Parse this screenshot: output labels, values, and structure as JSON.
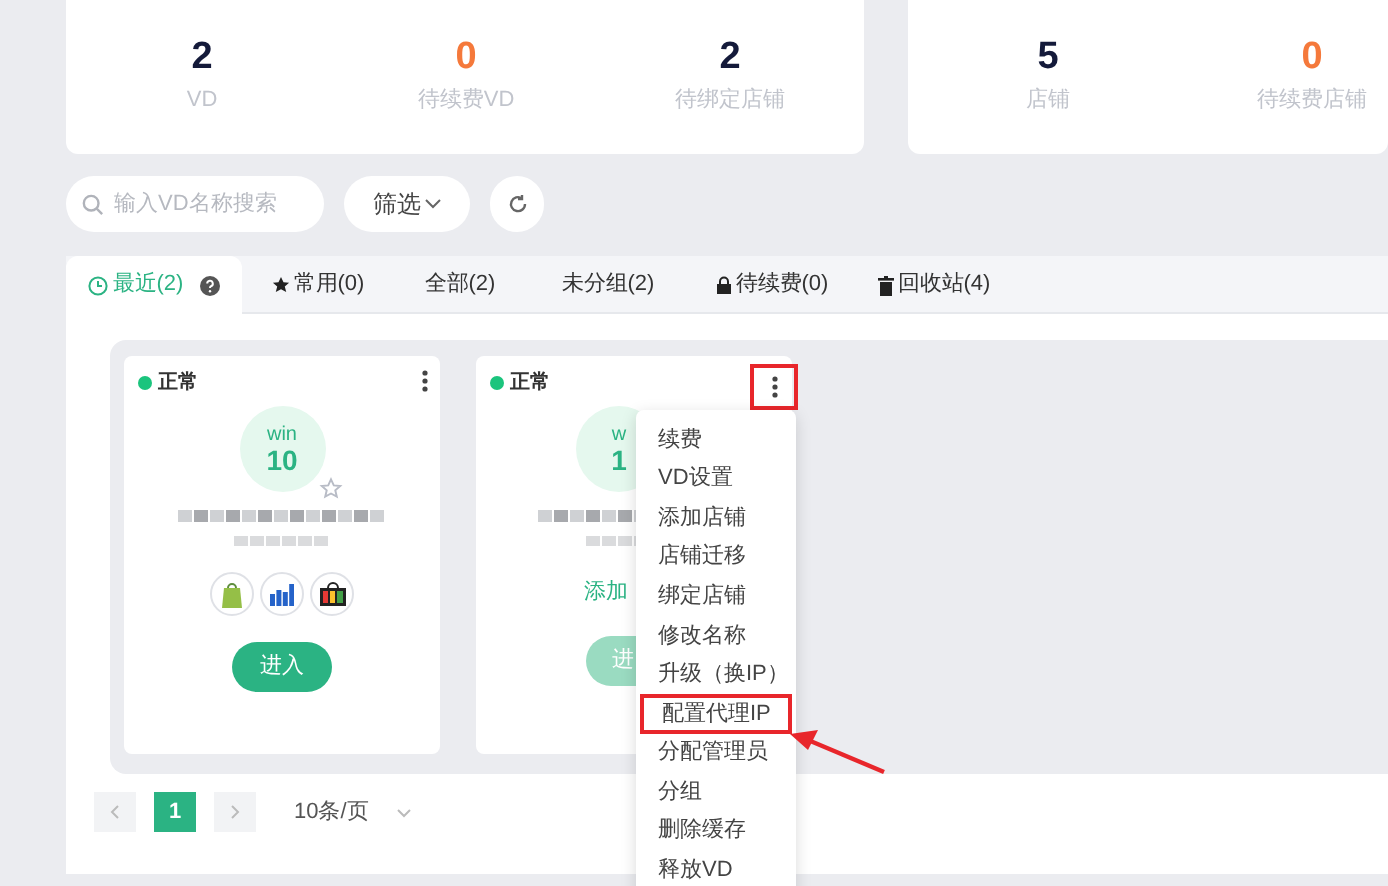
{
  "stats_left": [
    {
      "value": "2",
      "label": "VD",
      "kind": "normal"
    },
    {
      "value": "0",
      "label": "待续费VD",
      "kind": "warning"
    },
    {
      "value": "2",
      "label": "待绑定店铺",
      "kind": "normal"
    }
  ],
  "stats_right": [
    {
      "value": "5",
      "label": "店铺",
      "kind": "normal"
    },
    {
      "value": "0",
      "label": "待续费店铺",
      "kind": "warning"
    }
  ],
  "search": {
    "placeholder": "输入VD名称搜索"
  },
  "filter_button": "筛选",
  "tabs": [
    {
      "label": "最近(2)",
      "kind": "recent",
      "selected": true,
      "help": true
    },
    {
      "label": "常用(0)",
      "kind": "favorite",
      "selected": false,
      "help": false
    },
    {
      "label": "全部(2)",
      "kind": "plain",
      "selected": false,
      "help": false
    },
    {
      "label": "未分组(2)",
      "kind": "plain",
      "selected": false,
      "help": false
    },
    {
      "label": "待续费(0)",
      "kind": "locked",
      "selected": false,
      "help": false
    },
    {
      "label": "回收站(4)",
      "kind": "bin",
      "selected": false,
      "help": false
    }
  ],
  "cards": [
    {
      "status": "正常",
      "os": "win",
      "version": "10",
      "enter": "进入",
      "enter_disabled": false,
      "menu_highlighted": false,
      "shops": [
        {
          "kind": "bag"
        },
        {
          "kind": "bars"
        },
        {
          "kind": "store"
        }
      ]
    },
    {
      "status": "正常",
      "os": "w",
      "version": "1",
      "link": "添加",
      "enter": "进",
      "enter_disabled": true,
      "menu_highlighted": true
    }
  ],
  "menu": [
    {
      "label": "续费",
      "highlighted": false
    },
    {
      "label": "VD设置",
      "highlighted": false
    },
    {
      "label": "添加店铺",
      "highlighted": false
    },
    {
      "label": "店铺迁移",
      "highlighted": false
    },
    {
      "label": "绑定店铺",
      "highlighted": false
    },
    {
      "label": "修改名称",
      "highlighted": false
    },
    {
      "label": "升级（换IP）",
      "highlighted": false
    },
    {
      "label": "配置代理IP",
      "highlighted": true
    },
    {
      "label": "分配管理员",
      "highlighted": false
    },
    {
      "label": "分组",
      "highlighted": false
    },
    {
      "label": "删除缓存",
      "highlighted": false
    },
    {
      "label": "释放VD",
      "highlighted": false
    }
  ],
  "pagination": {
    "pages": [
      {
        "label": "1",
        "selected": true
      }
    ],
    "page_size": "10条/页"
  }
}
